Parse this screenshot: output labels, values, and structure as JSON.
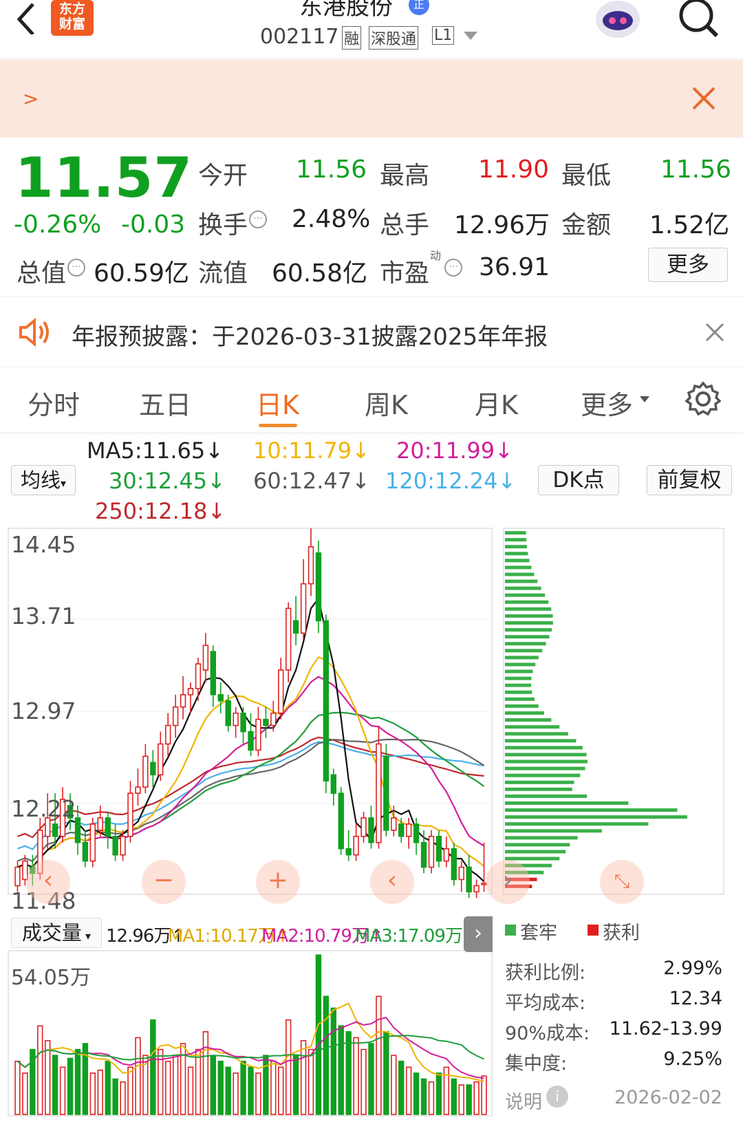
{
  "header": {
    "title": "东港股份",
    "badge": "正",
    "code": "002117",
    "tags": [
      "融",
      "深股通",
      "L1"
    ],
    "logo_line1": "东方",
    "logo_line2": "财富"
  },
  "banner": {
    "arrow": ">"
  },
  "quote": {
    "price": "11.57",
    "pct": "-0.26%",
    "chg": "-0.03",
    "open_label": "今开",
    "open": "11.56",
    "high_label": "最高",
    "high": "11.90",
    "low_label": "最低",
    "low": "11.56",
    "turnover_label": "换手",
    "turnover": "2.48%",
    "vol_label": "总手",
    "vol": "12.96万",
    "amount_label": "金额",
    "amount": "1.52亿",
    "mcap_label": "总值",
    "mcap": "60.59亿",
    "float_label": "流值",
    "float": "60.58亿",
    "pe_label": "市盈",
    "pe_sup": "动",
    "pe": "36.91",
    "more": "更多"
  },
  "notice": {
    "text": "年报预披露：于2026-03-31披露2025年年报"
  },
  "tabs": [
    "分时",
    "五日",
    "日K",
    "周K",
    "月K",
    "更多"
  ],
  "active_tab": "日K",
  "ma": {
    "ma5": "MA5:11.65↓",
    "ma10": "10:11.79↓",
    "ma20": "20:11.99↓",
    "ma30": "30:12.45↓",
    "ma60": "60:12.47↓",
    "ma120": "120:12.24↓",
    "ma250": "250:12.18↓"
  },
  "controls": {
    "avg": "均线",
    "dk": "DK点",
    "fq": "前复权"
  },
  "volume_bar": {
    "label": "成交量",
    "v": "12.96万↑",
    "ma1": "MA1:10.17万↑",
    "ma2": "MA2:10.79万↑",
    "ma3": "MA3:17.09万↓",
    "top": "54.05万"
  },
  "chips": {
    "trap": "套牢",
    "profit": "获利",
    "rows": [
      {
        "k": "获利比例:",
        "v": "2.99%"
      },
      {
        "k": "平均成本:",
        "v": "12.34"
      },
      {
        "k": "90%成本:",
        "v": "11.62-13.99"
      },
      {
        "k": "集中度:",
        "v": "9.25%"
      }
    ],
    "note": "说明",
    "date": "2026-02-02"
  },
  "colors": {
    "up": "#e02020",
    "down": "#10a020",
    "ma5": "#111111",
    "ma10": "#f0b400",
    "ma20": "#d21e9b",
    "ma30": "#1e9e3a",
    "ma60": "#666666",
    "ma120": "#4ab0e8",
    "ma250": "#c0282d"
  },
  "chart_data": {
    "type": "candlestick",
    "yticks": [
      "14.45",
      "13.71",
      "12.97",
      "12.22",
      "11.48"
    ],
    "ylim": [
      11.48,
      14.45
    ],
    "volume_ylim": [
      0,
      54.05
    ],
    "candles": [
      [
        11.55,
        11.7,
        11.5,
        11.75
      ],
      [
        11.6,
        11.75,
        11.55,
        11.8
      ],
      [
        11.7,
        11.65,
        11.55,
        11.8
      ],
      [
        11.65,
        12.0,
        11.6,
        12.1
      ],
      [
        11.95,
        12.1,
        11.85,
        12.3
      ],
      [
        12.05,
        11.95,
        11.85,
        12.3
      ],
      [
        11.95,
        12.25,
        11.9,
        12.35
      ],
      [
        12.2,
        12.1,
        12.0,
        12.3
      ],
      [
        12.1,
        11.9,
        11.8,
        12.2
      ],
      [
        11.9,
        11.75,
        11.7,
        12.0
      ],
      [
        11.75,
        12.05,
        11.7,
        12.1
      ],
      [
        12.0,
        12.1,
        11.95,
        12.2
      ],
      [
        12.1,
        11.95,
        11.85,
        12.15
      ],
      [
        11.95,
        11.8,
        11.75,
        12.05
      ],
      [
        11.8,
        11.95,
        11.75,
        12.0
      ],
      [
        11.95,
        12.3,
        11.9,
        12.4
      ],
      [
        12.3,
        12.35,
        12.2,
        12.5
      ],
      [
        12.35,
        12.6,
        12.3,
        12.7
      ],
      [
        12.55,
        12.45,
        12.35,
        12.65
      ],
      [
        12.45,
        12.7,
        12.4,
        12.8
      ],
      [
        12.7,
        12.85,
        12.6,
        12.95
      ],
      [
        12.85,
        13.0,
        12.75,
        13.1
      ],
      [
        13.0,
        13.1,
        12.9,
        13.25
      ],
      [
        13.1,
        13.15,
        12.95,
        13.2
      ],
      [
        13.15,
        13.35,
        13.05,
        13.4
      ],
      [
        13.3,
        13.5,
        13.2,
        13.6
      ],
      [
        13.45,
        13.1,
        13.0,
        13.5
      ],
      [
        13.1,
        13.05,
        12.95,
        13.2
      ],
      [
        13.05,
        12.85,
        12.8,
        13.1
      ],
      [
        12.85,
        12.95,
        12.75,
        13.0
      ],
      [
        12.95,
        12.8,
        12.7,
        13.0
      ],
      [
        12.8,
        12.65,
        12.6,
        12.95
      ],
      [
        12.65,
        12.9,
        12.6,
        13.0
      ],
      [
        12.9,
        12.85,
        12.75,
        13.0
      ],
      [
        12.85,
        12.95,
        12.8,
        13.05
      ],
      [
        12.95,
        13.3,
        12.9,
        13.4
      ],
      [
        13.3,
        13.8,
        13.2,
        13.85
      ],
      [
        13.7,
        13.6,
        13.5,
        13.9
      ],
      [
        13.6,
        14.0,
        13.55,
        14.2
      ],
      [
        14.0,
        14.3,
        13.9,
        14.45
      ],
      [
        14.25,
        13.7,
        13.6,
        14.35
      ],
      [
        13.7,
        12.4,
        12.3,
        13.75
      ],
      [
        12.45,
        12.3,
        12.2,
        12.5
      ],
      [
        12.3,
        11.85,
        11.8,
        12.35
      ],
      [
        11.85,
        11.8,
        11.75,
        12.0
      ],
      [
        11.8,
        11.95,
        11.75,
        12.05
      ],
      [
        11.95,
        12.1,
        11.9,
        12.15
      ],
      [
        12.1,
        11.9,
        11.85,
        12.2
      ],
      [
        11.9,
        12.7,
        11.85,
        12.85
      ],
      [
        12.6,
        12.0,
        11.95,
        12.7
      ],
      [
        12.0,
        12.1,
        11.95,
        12.2
      ],
      [
        12.05,
        11.95,
        11.9,
        12.1
      ],
      [
        11.95,
        12.05,
        11.85,
        12.1
      ],
      [
        12.05,
        11.9,
        11.8,
        12.1
      ],
      [
        11.9,
        11.7,
        11.65,
        12.0
      ],
      [
        11.7,
        11.95,
        11.65,
        12.0
      ],
      [
        11.95,
        11.75,
        11.7,
        12.0
      ],
      [
        11.75,
        11.85,
        11.7,
        11.95
      ],
      [
        11.85,
        11.6,
        11.55,
        11.9
      ],
      [
        11.6,
        11.7,
        11.5,
        11.75
      ],
      [
        11.7,
        11.5,
        11.45,
        11.8
      ],
      [
        11.5,
        11.55,
        11.45,
        11.6
      ],
      [
        11.56,
        11.57,
        11.5,
        11.9
      ]
    ],
    "volumes": [
      18,
      14,
      22,
      30,
      25,
      20,
      16,
      19,
      22,
      24,
      14,
      15,
      18,
      12,
      11,
      16,
      26,
      20,
      32,
      22,
      18,
      20,
      24,
      16,
      22,
      28,
      20,
      18,
      16,
      14,
      18,
      16,
      14,
      20,
      18,
      16,
      32,
      20,
      25,
      22,
      54,
      40,
      36,
      30,
      28,
      26,
      22,
      24,
      40,
      28,
      20,
      18,
      16,
      14,
      12,
      11,
      14,
      16,
      12,
      10,
      10,
      11,
      13
    ],
    "chip_peak": "12.10"
  }
}
